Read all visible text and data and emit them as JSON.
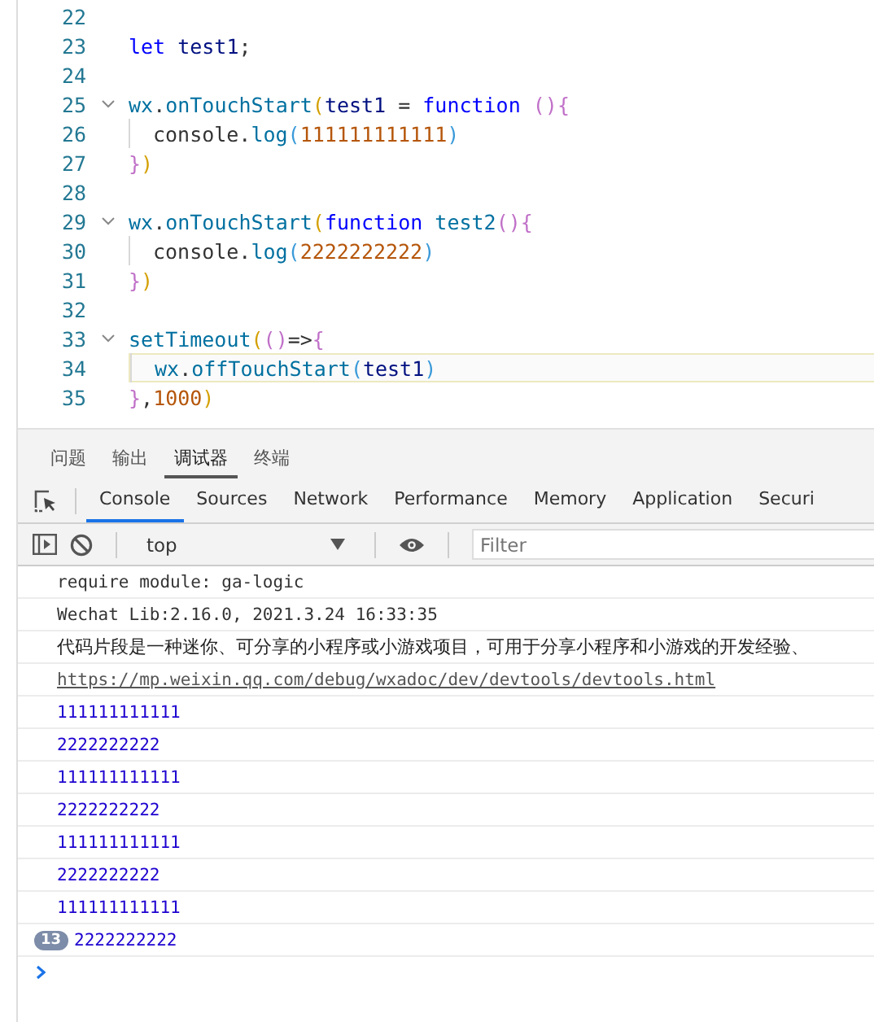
{
  "editor": {
    "lines": [
      {
        "number": "22",
        "foldable": false,
        "active": false,
        "indent": false
      },
      {
        "number": "23",
        "foldable": false,
        "active": false,
        "indent": false,
        "tokens": [
          {
            "kind": "kw",
            "text": "let "
          },
          {
            "kind": "var",
            "text": "test1"
          },
          {
            "kind": "plain",
            "text": ";"
          }
        ]
      },
      {
        "number": "24",
        "foldable": false,
        "active": false,
        "indent": false
      },
      {
        "number": "25",
        "foldable": true,
        "active": false,
        "indent": false,
        "tokens": [
          {
            "kind": "fn",
            "text": "wx"
          },
          {
            "kind": "plain",
            "text": "."
          },
          {
            "kind": "fn",
            "text": "onTouchStart"
          },
          {
            "kind": "br1",
            "text": "("
          },
          {
            "kind": "var",
            "text": "test1"
          },
          {
            "kind": "plain",
            "text": " = "
          },
          {
            "kind": "kw",
            "text": "function"
          },
          {
            "kind": "br2",
            "text": " (){"
          }
        ]
      },
      {
        "number": "26",
        "foldable": false,
        "active": false,
        "indent": true,
        "tokens": [
          {
            "kind": "plain",
            "text": "console."
          },
          {
            "kind": "fn",
            "text": "log"
          },
          {
            "kind": "br3",
            "text": "("
          },
          {
            "kind": "num",
            "text": "111111111111"
          },
          {
            "kind": "br3",
            "text": ")"
          }
        ]
      },
      {
        "number": "27",
        "foldable": false,
        "active": false,
        "indent": false,
        "tokens": [
          {
            "kind": "br2",
            "text": "}"
          },
          {
            "kind": "br1",
            "text": ")"
          }
        ]
      },
      {
        "number": "28",
        "foldable": false,
        "active": false,
        "indent": false
      },
      {
        "number": "29",
        "foldable": true,
        "active": false,
        "indent": false,
        "tokens": [
          {
            "kind": "fn",
            "text": "wx"
          },
          {
            "kind": "plain",
            "text": "."
          },
          {
            "kind": "fn",
            "text": "onTouchStart"
          },
          {
            "kind": "br1",
            "text": "("
          },
          {
            "kind": "kw",
            "text": "function "
          },
          {
            "kind": "fn",
            "text": "test2"
          },
          {
            "kind": "br2",
            "text": "(){"
          }
        ]
      },
      {
        "number": "30",
        "foldable": false,
        "active": false,
        "indent": true,
        "tokens": [
          {
            "kind": "plain",
            "text": "console."
          },
          {
            "kind": "fn",
            "text": "log"
          },
          {
            "kind": "br3",
            "text": "("
          },
          {
            "kind": "num",
            "text": "2222222222"
          },
          {
            "kind": "br3",
            "text": ")"
          }
        ]
      },
      {
        "number": "31",
        "foldable": false,
        "active": false,
        "indent": false,
        "tokens": [
          {
            "kind": "br2",
            "text": "}"
          },
          {
            "kind": "br1",
            "text": ")"
          }
        ]
      },
      {
        "number": "32",
        "foldable": false,
        "active": false,
        "indent": false
      },
      {
        "number": "33",
        "foldable": true,
        "active": false,
        "indent": false,
        "tokens": [
          {
            "kind": "fn",
            "text": "setTimeout"
          },
          {
            "kind": "br1",
            "text": "("
          },
          {
            "kind": "br2",
            "text": "()"
          },
          {
            "kind": "plain",
            "text": "=>"
          },
          {
            "kind": "br2",
            "text": "{"
          }
        ]
      },
      {
        "number": "34",
        "foldable": false,
        "active": true,
        "indent": true,
        "tokens": [
          {
            "kind": "fn",
            "text": "wx"
          },
          {
            "kind": "plain",
            "text": "."
          },
          {
            "kind": "fn",
            "text": "offTouchStart"
          },
          {
            "kind": "br3",
            "text": "("
          },
          {
            "kind": "var",
            "text": "test1"
          },
          {
            "kind": "br3",
            "text": ")"
          }
        ]
      },
      {
        "number": "35",
        "foldable": false,
        "active": false,
        "indent": false,
        "tokens": [
          {
            "kind": "br2",
            "text": "}"
          },
          {
            "kind": "plain",
            "text": ","
          },
          {
            "kind": "num",
            "text": "1000"
          },
          {
            "kind": "br1",
            "text": ")"
          }
        ]
      }
    ]
  },
  "panel_tabs": [
    {
      "label": "问题",
      "selected": false
    },
    {
      "label": "输出",
      "selected": false
    },
    {
      "label": "调试器",
      "selected": true
    },
    {
      "label": "终端",
      "selected": false
    }
  ],
  "devtools_tabs": [
    {
      "label": "Console",
      "selected": true
    },
    {
      "label": "Sources",
      "selected": false
    },
    {
      "label": "Network",
      "selected": false
    },
    {
      "label": "Performance",
      "selected": false
    },
    {
      "label": "Memory",
      "selected": false
    },
    {
      "label": "Application",
      "selected": false
    },
    {
      "label": "Securi",
      "selected": false
    }
  ],
  "toolbar": {
    "context": "top",
    "filter": {
      "placeholder": "Filter"
    }
  },
  "messages": [
    {
      "kind": "mono",
      "text": "require module: ga-logic"
    },
    {
      "kind": "mono",
      "text": "Wechat Lib:2.16.0, 2021.3.24 16:33:35"
    },
    {
      "kind": "text",
      "text": "代码片段是一种迷你、可分享的小程序或小游戏项目，可用于分享小程序和小游戏的开发经验、"
    },
    {
      "kind": "link",
      "text": "https://mp.weixin.qq.com/debug/wxadoc/dev/devtools/devtools.html"
    },
    {
      "kind": "number",
      "text": "111111111111"
    },
    {
      "kind": "number",
      "text": "2222222222"
    },
    {
      "kind": "number",
      "text": "111111111111"
    },
    {
      "kind": "number",
      "text": "2222222222"
    },
    {
      "kind": "number",
      "text": "111111111111"
    },
    {
      "kind": "number",
      "text": "2222222222"
    },
    {
      "kind": "number",
      "text": "111111111111"
    },
    {
      "kind": "number",
      "text": "2222222222",
      "count": "13"
    }
  ]
}
